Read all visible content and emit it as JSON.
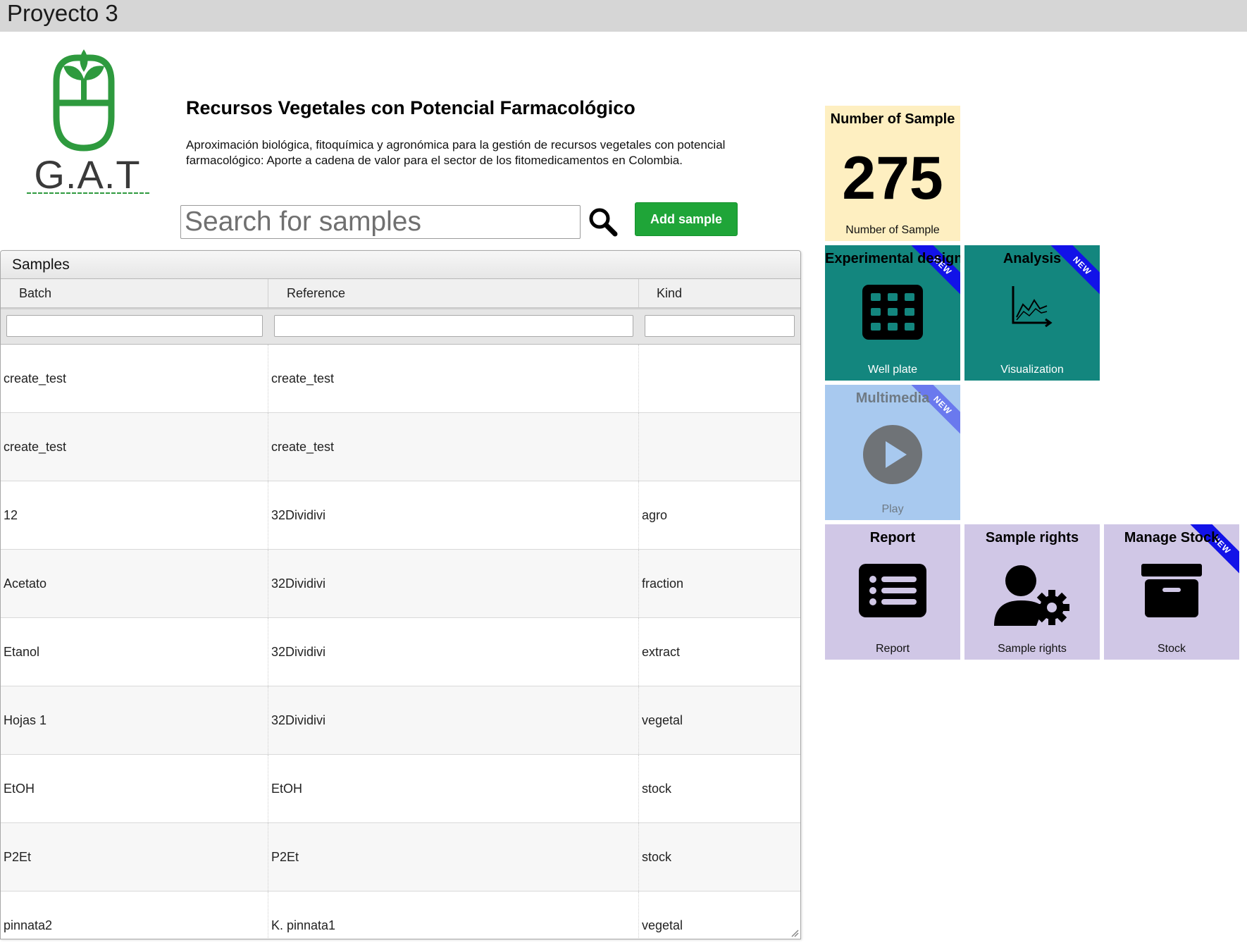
{
  "window": {
    "title": "Proyecto 3"
  },
  "logo": {
    "text": "G.A.T"
  },
  "project": {
    "title": "Recursos Vegetales con Potencial Farmacológico",
    "description": "Aproximación biológica, fitoquímica y agronómica para la gestión de recursos vegetales con potencial farmacológico: Aporte a cadena de valor para el sector de los fitomedicamentos en Colombia."
  },
  "search": {
    "placeholder": "Search for samples",
    "value": ""
  },
  "actions": {
    "add_sample": "Add sample"
  },
  "grid": {
    "title": "Samples",
    "columns": [
      "Batch",
      "Reference",
      "Kind"
    ],
    "rows": [
      {
        "batch": "create_test",
        "reference": "create_test",
        "kind": ""
      },
      {
        "batch": "create_test",
        "reference": "create_test",
        "kind": ""
      },
      {
        "batch": "12",
        "reference": "32Dividivi",
        "kind": "agro"
      },
      {
        "batch": "Acetato",
        "reference": "32Dividivi",
        "kind": "fraction"
      },
      {
        "batch": "Etanol",
        "reference": "32Dividivi",
        "kind": "extract"
      },
      {
        "batch": "Hojas 1",
        "reference": "32Dividivi",
        "kind": "vegetal"
      },
      {
        "batch": "EtOH",
        "reference": "EtOH",
        "kind": "stock"
      },
      {
        "batch": "P2Et",
        "reference": "P2Et",
        "kind": "stock"
      },
      {
        "batch": "pinnata2",
        "reference": "K. pinnata1",
        "kind": "vegetal"
      }
    ]
  },
  "tiles": {
    "count": {
      "title": "Number of Sample",
      "number": "275",
      "caption": "Number of Sample"
    },
    "experimental": {
      "title": "Experimental design",
      "caption": "Well plate",
      "badge": "NEW",
      "icon": "grid-icon"
    },
    "analysis": {
      "title": "Analysis",
      "caption": "Visualization",
      "badge": "NEW",
      "icon": "chart-icon"
    },
    "multimedia": {
      "title": "Multimedia",
      "caption": "Play",
      "badge": "NEW",
      "icon": "play-icon"
    },
    "report": {
      "title": "Report",
      "caption": "Report",
      "icon": "list-icon"
    },
    "rights": {
      "title": "Sample rights",
      "caption": "Sample rights",
      "icon": "user-gear-icon"
    },
    "stock": {
      "title": "Manage Stock",
      "caption": "Stock",
      "badge": "NEW",
      "icon": "archive-icon"
    }
  },
  "colors": {
    "topbar": "#d6d6d6",
    "add_button": "#1fa538",
    "count_tile": "#feefc1",
    "teal_tile": "#13867e",
    "multimedia_tile": "#a8c9ef",
    "lavender_tile": "#d0c7e6",
    "ribbon": "#1212e8"
  }
}
